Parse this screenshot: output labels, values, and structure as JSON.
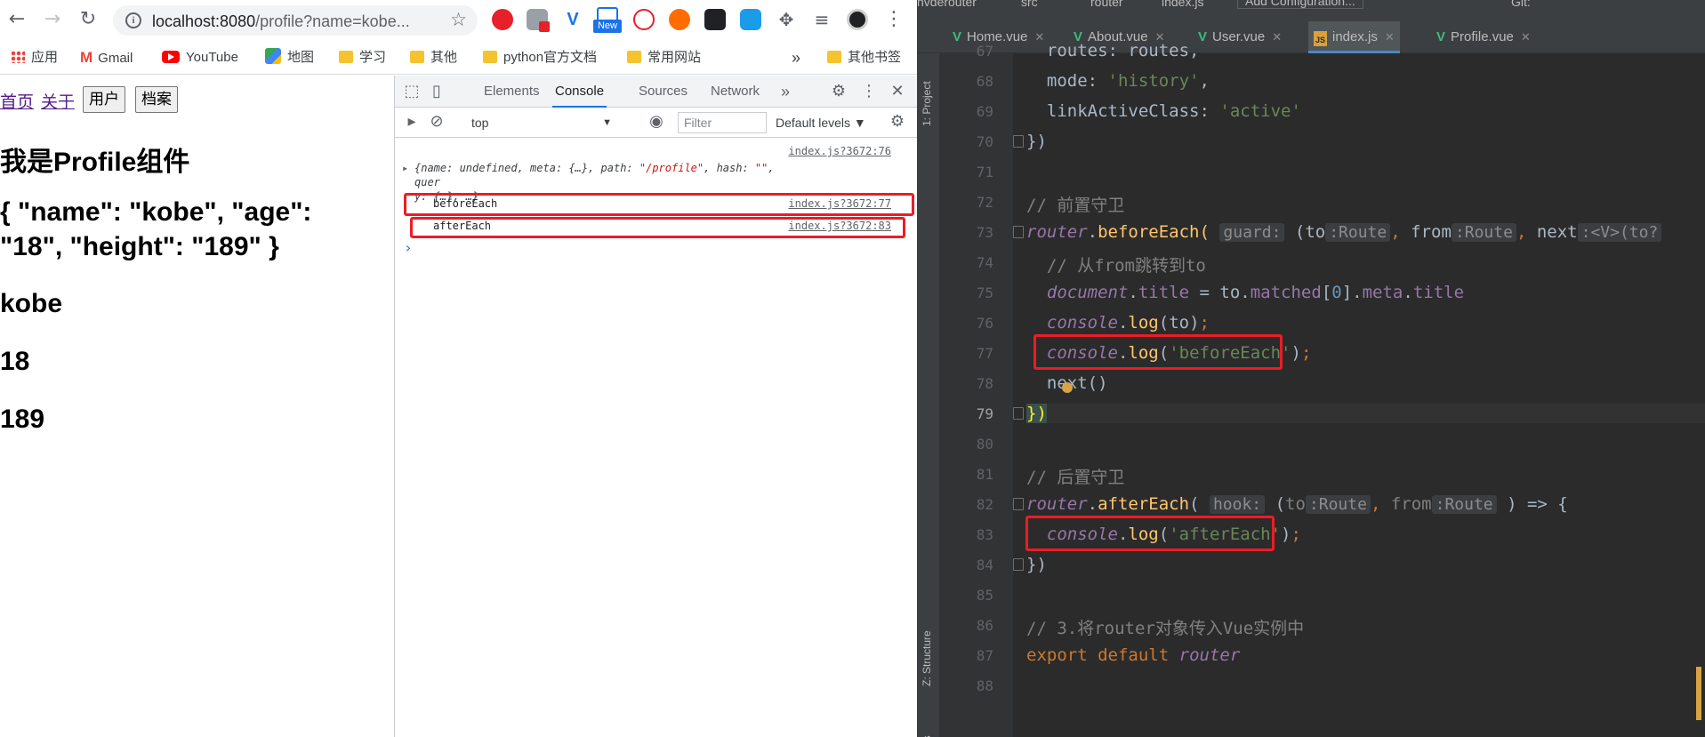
{
  "browser": {
    "url_host": "localhost:8080",
    "url_path": "/profile?name=kobe...",
    "bookmarks": {
      "apps": "应用",
      "gmail": "Gmail",
      "youtube": "YouTube",
      "maps": "地图",
      "study": "学习",
      "other": "其他",
      "python": "python官方文档",
      "common": "常用网站",
      "more": "»",
      "other_bookmarks": "其他书签"
    },
    "ext_new_label": "New"
  },
  "page": {
    "links": {
      "home": "首页",
      "about": "关于"
    },
    "buttons": {
      "user": "用户",
      "profile": "档案"
    },
    "heading": "我是Profile组件",
    "json_line1": "{ \"name\": \"kobe\", \"age\":",
    "json_line2": "\"18\", \"height\": \"189\" }",
    "name": "kobe",
    "age": "18",
    "height": "189"
  },
  "devtools": {
    "tabs": [
      "Elements",
      "Console",
      "Sources",
      "Network"
    ],
    "more_tabs": "»",
    "context": "top",
    "filter_placeholder": "Filter",
    "levels": "Default levels ▼",
    "logs": [
      {
        "src": "index.js?3672:76",
        "obj_a": "{name: undefined, meta: {…}, path: ",
        "obj_path": "\"/profile\"",
        "obj_b": ", hash: ",
        "obj_hash": "\"\"",
        "obj_c": ", quer",
        "obj_d": "y: {…}, …}"
      },
      {
        "text": "beforeEach",
        "src": "index.js?3672:77"
      },
      {
        "text": "afterEach",
        "src": "index.js?3672:83"
      }
    ],
    "prompt": "›"
  },
  "ide": {
    "breadcrumb": "nvderouter",
    "breadcrumb_src": "src",
    "breadcrumb_router": "router",
    "breadcrumb_file": "index.js",
    "run_config": "Add Configuration...",
    "git": "Git:",
    "tabs": [
      {
        "label": "Home.vue",
        "type": "vue"
      },
      {
        "label": "About.vue",
        "type": "vue"
      },
      {
        "label": "User.vue",
        "type": "vue"
      },
      {
        "label": "index.js",
        "type": "js"
      },
      {
        "label": "Profile.vue",
        "type": "vue"
      }
    ],
    "side_project": "1: Project",
    "side_structure": "Z: Structure",
    "side_favorites": "es",
    "line_numbers": [
      "67",
      "68",
      "69",
      "70",
      "71",
      "72",
      "73",
      "74",
      "75",
      "76",
      "77",
      "78",
      "79",
      "80",
      "81",
      "82",
      "83",
      "84",
      "85",
      "86",
      "87",
      "88"
    ],
    "code": {
      "l67": "routes: routes,",
      "l68_key": "mode",
      "l68_val": "'history'",
      "l69_key": "linkActiveClass",
      "l69_val": "'active'",
      "l70": "})",
      "l72": "// 前置守卫",
      "l73_obj": "router",
      "l73_fn": "beforeEach",
      "l73_hint": "guard:",
      "l73_to": "to",
      "l73_route1": ":Route",
      "l73_from": "from",
      "l73_route2": ":Route",
      "l73_next": "next",
      "l73_rest": ":<V>(to?",
      "l74": "// 从from跳转到to",
      "l75_doc": "document",
      "l75_title": "title",
      "l75_to": "to",
      "l75_matched": "matched",
      "l75_idx": "0",
      "l75_meta": "meta",
      "l75_title2": "title",
      "l76_console": "console",
      "l76_log": "log",
      "l76_arg": "to",
      "l77_console": "console",
      "l77_log": "log",
      "l77_str": "'beforeEach'",
      "l78": "next()",
      "l79": "})",
      "l81": "// 后置守卫",
      "l82_obj": "router",
      "l82_fn": "afterEach",
      "l82_hint": "hook:",
      "l82_to": "to",
      "l82_route1": ":Route",
      "l82_from": "from",
      "l82_route2": ":Route",
      "l82_arrow": ") => {",
      "l83_console": "console",
      "l83_log": "log",
      "l83_str": "'afterEach'",
      "l84": "})",
      "l86": "// 3.将router对象传入Vue实例中",
      "l87_export": "export",
      "l87_default": "default",
      "l87_router": "router"
    }
  },
  "colors": {
    "highlight_box": "#ed1c24",
    "ide_bg": "#2b2b2b",
    "keyword": "#cc7832",
    "string": "#6a8759",
    "comment": "#808080",
    "vue_green": "#42b883"
  }
}
